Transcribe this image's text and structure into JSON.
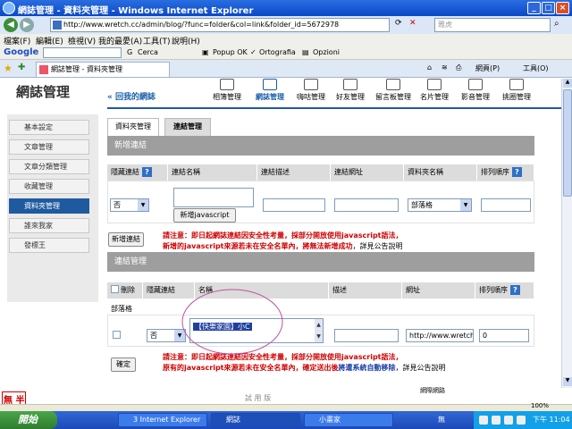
{
  "window": {
    "title": "網誌管理 - 資料夾管理 - Windows Internet Explorer",
    "url": "http://www.wretch.cc/admin/blog/?func=folder&col=link&folder_id=5672978",
    "search_placeholder": "雅虎",
    "minimize": "_",
    "maximize": "□",
    "close": "×"
  },
  "menubar": [
    "檔案(F)",
    "編輯(E)",
    "檢視(V)",
    "我的最愛(A)",
    "工具(T)",
    "說明(H)"
  ],
  "google_toolbar": {
    "logo": "Google",
    "cerca": "Cerca",
    "popup": "Popup OK",
    "ortografia": "Ortografia",
    "opzioni": "Opzioni"
  },
  "tabbar": {
    "tab_label": "網誌管理 - 資料夾管理",
    "page_menu": "網頁(P)",
    "tools_menu": "工具(O)"
  },
  "page": {
    "site_title": "網誌管理",
    "back_link": "« 回我的網誌",
    "top_nav": [
      {
        "label": "相簿管理"
      },
      {
        "label": "網誌管理"
      },
      {
        "label": "嗨咕管理"
      },
      {
        "label": "好友管理"
      },
      {
        "label": "留言板管理"
      },
      {
        "label": "名片管理"
      },
      {
        "label": "影音管理"
      },
      {
        "label": "挑圈管理"
      }
    ],
    "left_menu": [
      {
        "label": "基本設定"
      },
      {
        "label": "文章管理"
      },
      {
        "label": "文章分類管理"
      },
      {
        "label": "收藏管理"
      },
      {
        "label": "資料夾管理"
      },
      {
        "label": "誰來我家"
      },
      {
        "label": "發標王"
      }
    ],
    "tabs": [
      "資料夾管理",
      "連結管理"
    ],
    "new_link": {
      "header": "新增連結",
      "columns": [
        "隱藏連結",
        "連結名稱",
        "連結描述",
        "連結網址",
        "資料夾名稱",
        "排列順序"
      ],
      "hidden_value": "否",
      "add_js_button": "新增javascript",
      "folder_value": "部落格",
      "submit_button": "新增連結",
      "note_line1_red": "請注意：即日起網誌連結因安全性考量，採部分開放使用javascript語法，",
      "note_line2_red": "新增的javascript來源若未在安全名單內，將無法新增成功",
      "note_line2_tail": "，詳見公告說明"
    },
    "link_manage": {
      "header": "連結管理",
      "columns": [
        "刪除",
        "隱藏連結",
        "名稱",
        "描述",
        "網址",
        "排列順序"
      ],
      "group_label": "部落格",
      "row": {
        "hidden": "否",
        "name": "【快樂家園】小C",
        "description": "",
        "url": "http://www.wretch.c",
        "order": "0"
      },
      "confirm_button": "確定",
      "note_line1_red": "請注意：即日起網誌連結因安全性考量，採部分開放使用javascript語法，",
      "note_line2_red": "原有的javascript來源若未在安全名單內，確定送出後",
      "note_line2_blue": "將遭系統自動移除",
      "note_line2_tail": "，詳見公告說明"
    },
    "trial_text": "試 用 版",
    "stamp_text": "無 半"
  },
  "taskbar": {
    "start": "開始",
    "tasks": [
      {
        "label": "3 Internet Explorer"
      },
      {
        "label": "網誌"
      },
      {
        "label": "小畫家"
      }
    ],
    "language": "無",
    "clock": "下午 11:04",
    "zoom": "100%",
    "zone": "網際網路"
  },
  "colors": {
    "accent_blue": "#1f5aa0",
    "section_gray": "#9e9e9e",
    "warning_red": "#d00000"
  }
}
